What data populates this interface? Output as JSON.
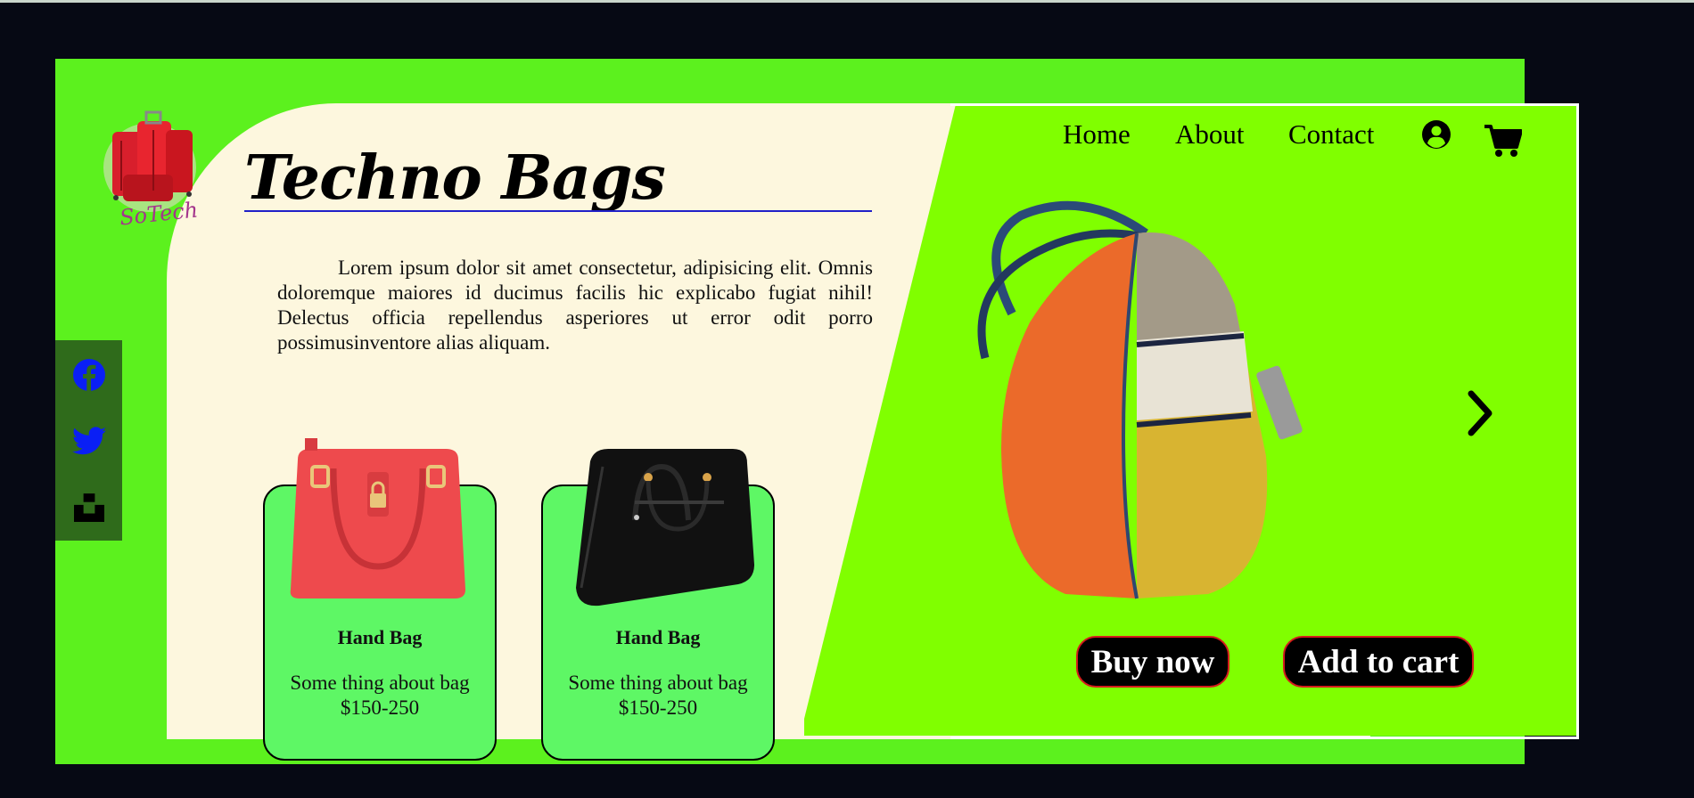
{
  "brand": {
    "logo_text": "SoTech",
    "title": "Techno Bags"
  },
  "intro": {
    "text": "Lorem ipsum dolor sit amet consectetur, adipisicing elit. Omnis doloremque maiores id ducimus facilis hic explicabo fugiat nihil! Delectus officia repellendus asperiores ut error odit porro possimusinventore alias aliquam."
  },
  "nav": {
    "items": [
      {
        "label": "Home"
      },
      {
        "label": "About"
      },
      {
        "label": "Contact"
      }
    ],
    "icons": [
      "user-circle-icon",
      "cart-icon"
    ]
  },
  "social": {
    "icons": [
      "facebook-icon",
      "twitter-icon",
      "unsplash-icon"
    ]
  },
  "cards": [
    {
      "title": "Hand Bag",
      "description": "Some thing about bag",
      "price": "$150-250",
      "color": "red"
    },
    {
      "title": "Hand Bag",
      "description": "Some thing about bag",
      "price": "$150-250",
      "color": "black"
    }
  ],
  "hero": {
    "buy_label": "Buy now",
    "cart_label": "Add to cart",
    "next_icon": "chevron-right-icon"
  },
  "colors": {
    "page_bg": "#060914",
    "stage_green": "#5cf11e",
    "hero_green": "#80ff00",
    "cream": "#fdf7de",
    "card_green": "#5ef765",
    "social_bg": "#2f6b1b",
    "social_icon": "#0a1ff5",
    "button_border": "#d41c1c"
  }
}
